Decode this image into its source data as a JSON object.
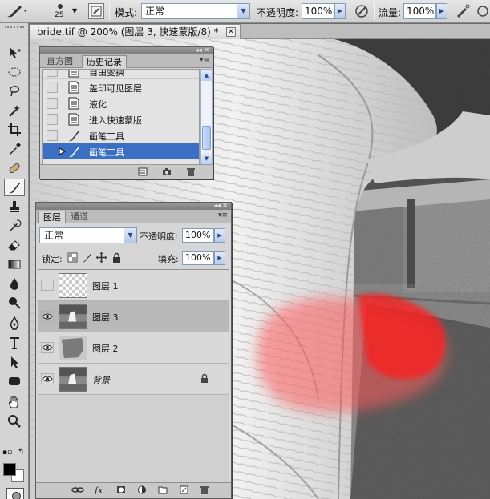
{
  "options_bar": {
    "brush_size": "25",
    "mode_label": "模式:",
    "mode_value": "正常",
    "opacity_label": "不透明度:",
    "opacity_value": "100%",
    "flow_label": "流量:",
    "flow_value": "100%"
  },
  "document": {
    "tab_title": "bride.tif @ 200% (图层 3, 快速蒙版/8) *",
    "close_glyph": "✕"
  },
  "history_panel": {
    "tabs": [
      "直方图",
      "历史记录"
    ],
    "active_tab": "历史记录",
    "items": [
      {
        "label": "自由变换",
        "icon": "doc-icon",
        "selected": false
      },
      {
        "label": "盖印可见图层",
        "icon": "doc-icon",
        "selected": false
      },
      {
        "label": "液化",
        "icon": "doc-icon",
        "selected": false
      },
      {
        "label": "进入快速蒙版",
        "icon": "doc-icon",
        "selected": false
      },
      {
        "label": "画笔工具",
        "icon": "brush-icon",
        "selected": false
      },
      {
        "label": "画笔工具",
        "icon": "brush-icon",
        "selected": true
      }
    ]
  },
  "layers_panel": {
    "tabs": [
      "图层",
      "通道"
    ],
    "active_tab": "图层",
    "blend_mode": "正常",
    "opacity_label": "不透明度:",
    "opacity_value": "100%",
    "lock_label": "锁定:",
    "fill_label": "填充:",
    "fill_value": "100%",
    "layers": [
      {
        "name": "图层 1",
        "visible": false,
        "selected": false,
        "thumb": "transparent"
      },
      {
        "name": "图层 3",
        "visible": true,
        "selected": true,
        "thumb": "photo"
      },
      {
        "name": "图层 2",
        "visible": true,
        "selected": false,
        "thumb": "shape"
      },
      {
        "name": "背景",
        "visible": true,
        "selected": false,
        "thumb": "photo",
        "locked": true
      }
    ],
    "footer_icons": [
      "link-icon",
      "fx-icon",
      "mask-icon",
      "adjustment-icon",
      "group-icon",
      "new-layer-icon",
      "trash-icon"
    ]
  },
  "colors": {
    "foreground": "#000000",
    "background": "#ffffff",
    "quickmask_overlay": "#ff3a3a",
    "selection": "#3a6fc4"
  }
}
